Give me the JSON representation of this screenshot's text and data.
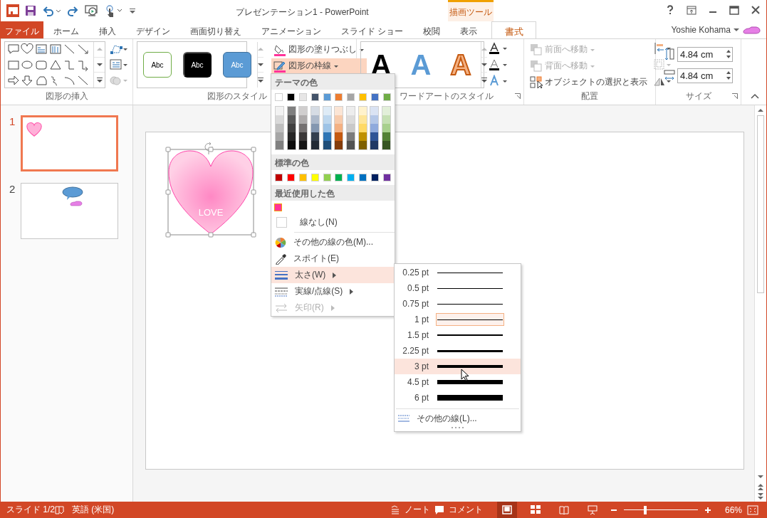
{
  "window": {
    "title": "プレゼンテーション1 - PowerPoint",
    "context_label": "描画ツール",
    "user": "Yoshie Kohama"
  },
  "tabs": [
    {
      "label": "ファイル",
      "kind": "file",
      "selected": false
    },
    {
      "label": "ホーム",
      "kind": "normal",
      "selected": false
    },
    {
      "label": "挿入",
      "kind": "normal",
      "selected": false
    },
    {
      "label": "デザイン",
      "kind": "normal",
      "selected": false
    },
    {
      "label": "画面切り替え",
      "kind": "normal",
      "selected": false
    },
    {
      "label": "アニメーション",
      "kind": "normal",
      "selected": false
    },
    {
      "label": "スライド ショー",
      "kind": "normal",
      "selected": false
    },
    {
      "label": "校閲",
      "kind": "normal",
      "selected": false
    },
    {
      "label": "表示",
      "kind": "normal",
      "selected": false
    },
    {
      "label": "書式",
      "kind": "context",
      "selected": true
    }
  ],
  "ribbon": {
    "group_labels": [
      "図形の挿入",
      "図形のスタイル",
      "ワードアートのスタイル",
      "配置",
      "サイズ"
    ],
    "shape_styles": [
      {
        "label": "Abc",
        "kind": "outline"
      },
      {
        "label": "Abc",
        "kind": "dark"
      },
      {
        "label": "Abc",
        "kind": "blue"
      }
    ],
    "fill_button": "図形の塗りつぶし",
    "outline_button": {
      "label": "図形の枠線",
      "expanded": true
    },
    "wordart": [
      {
        "label": "A",
        "kind": "black"
      },
      {
        "label": "A",
        "kind": "blue"
      },
      {
        "label": "A",
        "kind": "orange"
      }
    ],
    "arrange": [
      {
        "label": "前面へ移動",
        "disabled": true
      },
      {
        "label": "背面へ移動",
        "disabled": true
      },
      {
        "label": "オブジェクトの選択と表示",
        "disabled": false
      }
    ],
    "size": {
      "height": "4.84 cm",
      "width": "4.84 cm"
    }
  },
  "slides": [
    {
      "number": "1",
      "selected": true,
      "kind": "heart"
    },
    {
      "number": "2",
      "selected": false,
      "kind": "callout"
    }
  ],
  "slide": {
    "shape_text": "LOVE"
  },
  "outline_menu": {
    "theme_heading": "テーマの色",
    "theme_colors": [
      {
        "color": "#ffffff",
        "shades": [
          {
            "color": "#f2f2f2"
          },
          {
            "color": "#d9d9d9"
          },
          {
            "color": "#bfbfbf"
          },
          {
            "color": "#a6a6a6"
          },
          {
            "color": "#808080"
          }
        ]
      },
      {
        "color": "#000000",
        "shades": [
          {
            "color": "#7f7f7f"
          },
          {
            "color": "#595959"
          },
          {
            "color": "#404040"
          },
          {
            "color": "#262626"
          },
          {
            "color": "#0d0d0d"
          }
        ]
      },
      {
        "color": "#e7e6e6",
        "shades": [
          {
            "color": "#d0cece"
          },
          {
            "color": "#aeabab"
          },
          {
            "color": "#757171"
          },
          {
            "color": "#3b3838"
          },
          {
            "color": "#171616"
          }
        ]
      },
      {
        "color": "#44546a",
        "shades": [
          {
            "color": "#d6dce4"
          },
          {
            "color": "#adb9ca"
          },
          {
            "color": "#8497b0"
          },
          {
            "color": "#333f4f"
          },
          {
            "color": "#222a35"
          }
        ]
      },
      {
        "color": "#5b9bd5",
        "shades": [
          {
            "color": "#deebf6"
          },
          {
            "color": "#bdd7ee"
          },
          {
            "color": "#9dc3e6"
          },
          {
            "color": "#2e75b5"
          },
          {
            "color": "#1f4e79"
          }
        ]
      },
      {
        "color": "#ed7d31",
        "shades": [
          {
            "color": "#fbe5d5"
          },
          {
            "color": "#f7cbac"
          },
          {
            "color": "#f4b183"
          },
          {
            "color": "#c55a11"
          },
          {
            "color": "#843c0b"
          }
        ]
      },
      {
        "color": "#a5a5a5",
        "shades": [
          {
            "color": "#ededed"
          },
          {
            "color": "#dbdbdb"
          },
          {
            "color": "#c9c9c9"
          },
          {
            "color": "#7b7b7b"
          },
          {
            "color": "#525252"
          }
        ]
      },
      {
        "color": "#ffc000",
        "shades": [
          {
            "color": "#fff2cc"
          },
          {
            "color": "#fee599"
          },
          {
            "color": "#ffd965"
          },
          {
            "color": "#bf9000"
          },
          {
            "color": "#7f6000"
          }
        ]
      },
      {
        "color": "#4472c4",
        "shades": [
          {
            "color": "#dae3f3"
          },
          {
            "color": "#b4c7e7"
          },
          {
            "color": "#8faadc"
          },
          {
            "color": "#2f5496"
          },
          {
            "color": "#1f3864"
          }
        ]
      },
      {
        "color": "#70ad47",
        "shades": [
          {
            "color": "#e2efd9"
          },
          {
            "color": "#c5e0b3"
          },
          {
            "color": "#a8d08d"
          },
          {
            "color": "#538135"
          },
          {
            "color": "#375623"
          }
        ]
      }
    ],
    "standard_heading": "標準の色",
    "standard_colors": [
      {
        "color": "#c00000"
      },
      {
        "color": "#ff0000"
      },
      {
        "color": "#ffc000"
      },
      {
        "color": "#ffff00"
      },
      {
        "color": "#92d050"
      },
      {
        "color": "#00b050"
      },
      {
        "color": "#00b0f0"
      },
      {
        "color": "#0070c0"
      },
      {
        "color": "#002060"
      },
      {
        "color": "#7030a0"
      }
    ],
    "recent_heading": "最近使用した色",
    "recent_colors": [
      {
        "color": "#ff3399"
      }
    ],
    "items": [
      {
        "label": "線なし(N)",
        "kind": "none",
        "hovered": false,
        "disabled": false
      },
      {
        "label": "その他の線の色(M)...",
        "kind": "palette",
        "hovered": false,
        "disabled": false
      },
      {
        "label": "スポイト(E)",
        "kind": "eyedropper",
        "hovered": false,
        "disabled": false
      },
      {
        "label": "太さ(W)",
        "kind": "weight",
        "hovered": true,
        "disabled": false
      },
      {
        "label": "実線/点線(S)",
        "kind": "dash",
        "hovered": false,
        "disabled": false
      },
      {
        "label": "矢印(R)",
        "kind": "arrow",
        "hovered": false,
        "disabled": true
      }
    ]
  },
  "weight_menu": {
    "items": [
      {
        "label": "0.25 pt",
        "current": false,
        "hovered": false
      },
      {
        "label": "0.5 pt",
        "current": false,
        "hovered": false
      },
      {
        "label": "0.75 pt",
        "current": false,
        "hovered": false
      },
      {
        "label": "1 pt",
        "current": true,
        "hovered": false
      },
      {
        "label": "1.5 pt",
        "current": false,
        "hovered": false
      },
      {
        "label": "2.25 pt",
        "current": false,
        "hovered": false
      },
      {
        "label": "3 pt",
        "current": false,
        "hovered": true
      },
      {
        "label": "4.5 pt",
        "current": false,
        "hovered": false
      },
      {
        "label": "6 pt",
        "current": false,
        "hovered": false
      }
    ],
    "more": "その他の線(L)..."
  },
  "status_bar": {
    "slide": "スライド 1/2",
    "language": "英語 (米国)",
    "notes": "ノート",
    "comments": "コメント",
    "views": [
      {
        "kind": "normal",
        "selected": true
      },
      {
        "kind": "sorter",
        "selected": false
      },
      {
        "kind": "reading",
        "selected": false
      },
      {
        "kind": "show",
        "selected": false
      }
    ],
    "zoom": {
      "level": 0.29
    },
    "zoom_text": "66%"
  }
}
